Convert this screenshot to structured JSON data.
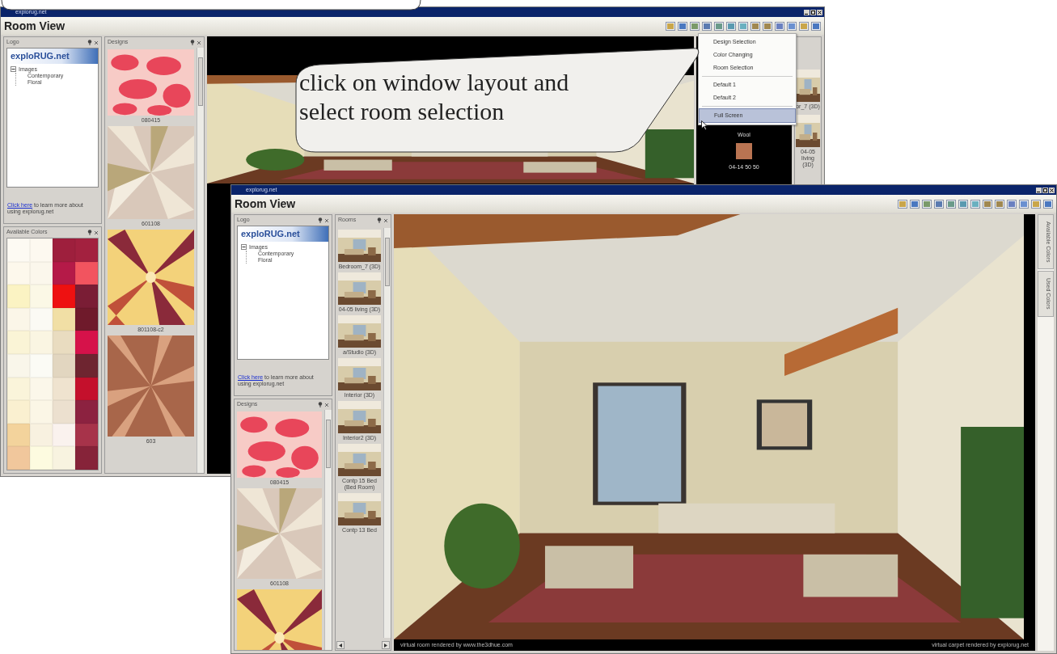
{
  "back_window": {
    "title": "explorug.net",
    "heading": "Room View",
    "logo_panel": {
      "title": "Logo",
      "logo": "exploRUG.net",
      "tree": [
        {
          "label": "Images",
          "expanded": true,
          "children": [
            {
              "label": "Contemporary"
            },
            {
              "label": "Floral"
            }
          ]
        }
      ],
      "help_link": "Click here",
      "help_text": "to learn more about using explorug.net"
    },
    "colors_panel": {
      "title": "Available Colors",
      "swatches": [
        {
          "color": "#fdfaf3"
        },
        {
          "color": "#fdf9f0"
        },
        {
          "color": "#9e1f3d"
        },
        {
          "color": "#a3213f"
        },
        {
          "color": "#fdf8ec"
        },
        {
          "color": "#fbf7ec"
        },
        {
          "color": "#b51a48"
        },
        {
          "color": "#f2545f"
        },
        {
          "color": "#fbf3c3"
        },
        {
          "color": "#fbf8e6"
        },
        {
          "color": "#ee1111"
        },
        {
          "color": "#7a1d35"
        },
        {
          "color": "#fbf6e8"
        },
        {
          "color": "#fbfaf4"
        },
        {
          "color": "#f1dfa5"
        },
        {
          "color": "#6f1a2b"
        },
        {
          "color": "#faf4d6"
        },
        {
          "color": "#faf5e2"
        },
        {
          "color": "#e9dcc0"
        },
        {
          "color": "#d6124a"
        },
        {
          "color": "#f9f6ea"
        },
        {
          "color": "#fbfbf5"
        },
        {
          "color": "#e2d6c0"
        },
        {
          "color": "#6e2530"
        },
        {
          "color": "#faf4da"
        },
        {
          "color": "#fbf7ea"
        },
        {
          "color": "#efe3cf"
        },
        {
          "color": "#c4102c"
        },
        {
          "color": "#faf0d0"
        },
        {
          "color": "#fbf6e6"
        },
        {
          "color": "#ece0cf"
        },
        {
          "color": "#8c2240"
        },
        {
          "color": "#f3d39c"
        },
        {
          "color": "#f8f1e0"
        },
        {
          "color": "#faf2ee"
        },
        {
          "color": "#a7334a"
        },
        {
          "color": "#f1c79c"
        },
        {
          "color": "#fdfbe0"
        },
        {
          "color": "#f8f3e0"
        },
        {
          "color": "#862339"
        }
      ]
    },
    "designs_panel": {
      "title": "Designs",
      "items": [
        {
          "label": "080415"
        },
        {
          "label": "601108"
        },
        {
          "label": "801108-c2"
        },
        {
          "label": "603"
        }
      ]
    },
    "layout_menu": {
      "items": [
        {
          "label": "Design Selection",
          "selected": false
        },
        {
          "label": "Color Changing",
          "selected": false
        },
        {
          "label": "Room Selection",
          "selected": false
        },
        {
          "label": "Default 1",
          "selected": false
        },
        {
          "label": "Default 2",
          "selected": false
        },
        {
          "label": "Full Screen",
          "selected": true
        }
      ]
    },
    "design_info": {
      "material": "Wool",
      "color": "#b97452",
      "code": "04-14 50 50"
    },
    "rooms_panel": {
      "items": [
        {
          "label": "or_7 (3D)"
        },
        {
          "label": "04-05 living (3D)"
        }
      ]
    }
  },
  "callout": {
    "text": "click on window layout and\nselect room selection"
  },
  "front_window": {
    "title": "explorug.net",
    "heading": "Room View",
    "logo_panel": {
      "title": "Logo",
      "logo": "exploRUG.net",
      "tree": [
        {
          "label": "Images",
          "expanded": true,
          "children": [
            {
              "label": "Contemporary"
            },
            {
              "label": "Floral"
            }
          ]
        }
      ],
      "help_link": "Click here",
      "help_text": "to learn more about using explorug.net"
    },
    "designs_panel": {
      "title": "Designs",
      "items": [
        {
          "label": "080415"
        },
        {
          "label": "601108"
        },
        {
          "kind": "picture"
        }
      ]
    },
    "rooms_panel": {
      "title": "Rooms",
      "items": [
        {
          "label": "Bedroom_7 (3D)"
        },
        {
          "label": "04-05 living (3D)"
        },
        {
          "label": "a/Studio (3D)"
        },
        {
          "label": "Interior (3D)"
        },
        {
          "label": "Interior2 (3D)"
        },
        {
          "label": "Contp 15 Bed (Bed Room)"
        },
        {
          "label": "Contp 13 Bed"
        }
      ]
    },
    "footer_left": "virtual room rendered by www.the3dhue.com",
    "footer_right": "virtual carpet rendered by explorug.net",
    "side_tabs": [
      {
        "label": "Available Colors"
      },
      {
        "label": "Used Colors"
      }
    ]
  }
}
